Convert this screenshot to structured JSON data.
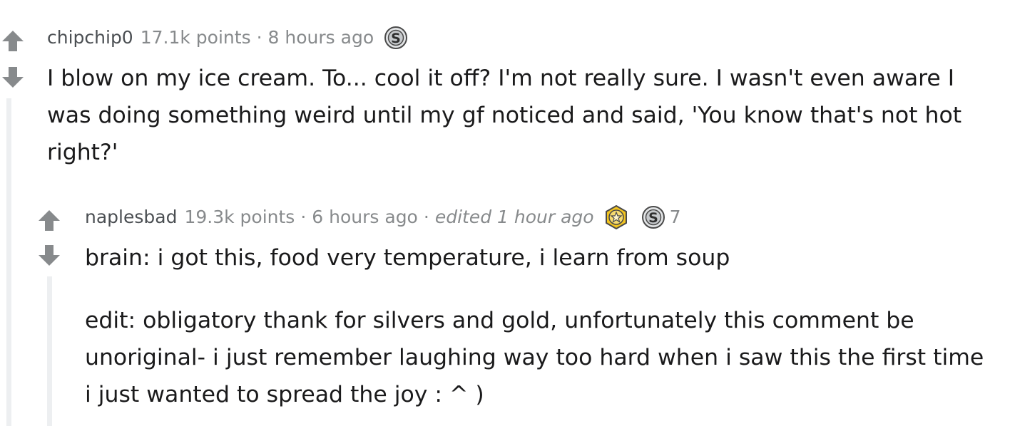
{
  "comments": [
    {
      "author": "chipchip0",
      "points": "17.1k points",
      "separator": "·",
      "time": "8 hours ago",
      "awards": [
        {
          "icon": "silver-award-icon",
          "count": ""
        }
      ],
      "body": [
        "I blow on my ice cream. To... cool it off? I'm not really sure. I wasn't even aware I was doing something weird until my gf noticed and said, 'You know that's not hot right?'"
      ]
    },
    {
      "author": "naplesbad",
      "points": "19.3k points",
      "separator": "·",
      "time": "6 hours ago",
      "edited": "edited 1 hour ago",
      "awards": [
        {
          "icon": "gold-award-icon",
          "count": ""
        },
        {
          "icon": "silver-award-icon",
          "count": "7"
        }
      ],
      "body": [
        "brain: i got this, food very temperature, i learn from soup",
        "edit: obligatory thank for silvers and gold, unfortunately this comment be unoriginal- i just remember laughing way too hard when i saw this the first time i just wanted to spread the joy : ^ )"
      ]
    }
  ],
  "colors": {
    "arrow": "#878a8c",
    "thread_line": "#edeff1",
    "meta_text": "#878a8c",
    "author_text": "#4b4f53",
    "body_text": "#1a1a1b",
    "silver": "#c6c9cc",
    "gold": "#f2c41f"
  }
}
